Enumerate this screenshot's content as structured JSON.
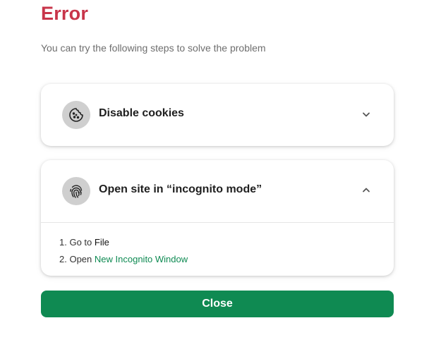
{
  "title": "Error",
  "subtitle": "You can try the following steps to solve the problem",
  "options": [
    {
      "label": "Disable cookies",
      "icon": "cookie-icon",
      "expanded": false
    },
    {
      "label": "Open site in “incognito mode”",
      "icon": "fingerprint-icon",
      "expanded": true,
      "steps": [
        {
          "number": "1.",
          "prefix": "Go to",
          "target": "File"
        },
        {
          "number": "2.",
          "prefix": "Open",
          "target": "New Incognito Window"
        }
      ]
    }
  ],
  "close_label": "Close",
  "colors": {
    "title": "#c8354a",
    "accent": "#0f8a52",
    "link": "#0e8a52",
    "icon_bg": "#cfcfcf"
  }
}
